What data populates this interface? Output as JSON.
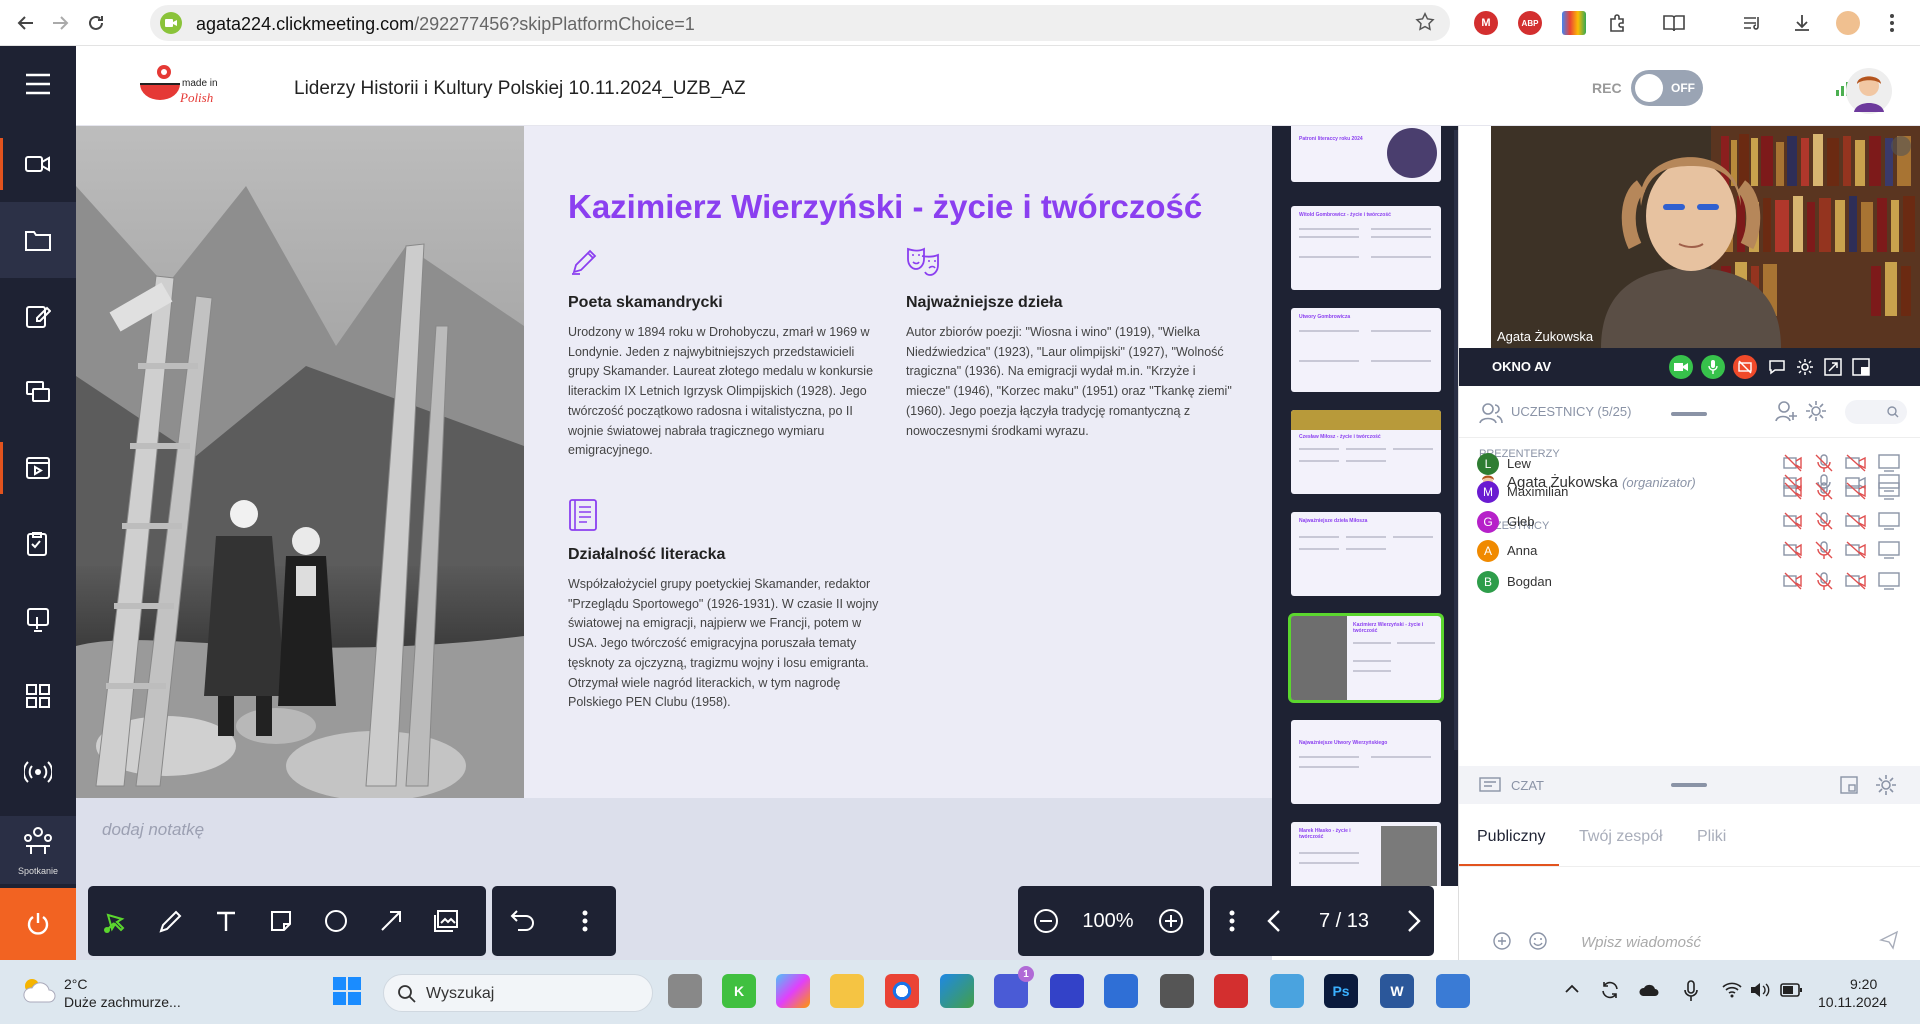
{
  "browser": {
    "url_host": "agata224.clickmeeting.com",
    "url_path": "/292277456?skipPlatformChoice=1"
  },
  "header": {
    "logo_text": "made in Polish",
    "title": "Liderzy Historii i Kultury Polskiej 10.11.2024_UZB_AZ",
    "rec_label": "REC",
    "rec_state": "OFF"
  },
  "rail": {
    "spotkanie_label": "Spotkanie"
  },
  "slide": {
    "title": "Kazimierz Wierzyński - życie i twórczość",
    "sections": [
      {
        "heading": "Poeta skamandrycki",
        "text": "Urodzony w 1894 roku w Drohobyczu, zmarł w 1969 w Londynie. Jeden z najwybitniejszych przedstawicieli grupy Skamander. Laureat złotego medalu w konkursie literackim IX Letnich Igrzysk Olimpijskich (1928). Jego twórczość początkowo radosna i witalistyczna, po II wojnie światowej nabrała tragicznego wymiaru emigracyjnego."
      },
      {
        "heading": "Najważniejsze dzieła",
        "text": "Autor zbiorów poezji: \"Wiosna i wino\" (1919), \"Wielka Niedźwiedzica\" (1923), \"Laur olimpijski\" (1927), \"Wolność tragiczna\" (1936). Na emigracji wydał m.in. \"Krzyże i miecze\" (1946), \"Korzec maku\" (1951) oraz \"Tkankę ziemi\" (1960). Jego poezja łączyła tradycję romantyczną z nowoczesnymi środkami wyrazu."
      },
      {
        "heading": "Działalność literacka",
        "text": "Współzałożyciel grupy poetyckiej Skamander, redaktor \"Przeglądu Sportowego\" (1926-1931). W czasie II wojny światowej na emigracji, najpierw we Francji, potem w USA. Jego twórczość emigracyjna poruszała tematy tęsknoty za ojczyzną, tragizmu wojny i losu emigranta. Otrzymał wiele nagród literackich, w tym nagrodę Polskiego PEN Clubu (1958)."
      }
    ],
    "note_placeholder": "dodaj notatkę"
  },
  "thumbnails": [
    {
      "title": "Patroni literaccy roku 2024"
    },
    {
      "title": "Witold Gombrowicz - życie i twórczość"
    },
    {
      "title": "Utwory Gombrowicza"
    },
    {
      "title": "Czesław Miłosz - życie i twórczość"
    },
    {
      "title": "Najważniejsze dzieła Miłosza"
    },
    {
      "title": "Kazimierz Wierzyński - życie i twórczość"
    },
    {
      "title": "Najważniejsze Utwory Wierzyńskiego"
    },
    {
      "title": "Marek Hłasko - życie i twórczość"
    }
  ],
  "viewer": {
    "zoom": "100%",
    "page_indicator": "7 / 13"
  },
  "video": {
    "presenter_name": "Agata Żukowska",
    "window_title": "OKNO AV"
  },
  "participants": {
    "title": "UCZESTNICY (5/25)",
    "presenters_label": "PREZENTERZY",
    "presenter_name": "Agata Żukowska",
    "presenter_role": "(organizator)",
    "attendees_label": "UCZESTNICY",
    "list": [
      {
        "initial": "L",
        "name": "Lew",
        "color": "#2e7d32"
      },
      {
        "initial": "M",
        "name": "Maximilian",
        "color": "#6a1bd1"
      },
      {
        "initial": "G",
        "name": "Gleb",
        "color": "#b621c9"
      },
      {
        "initial": "A",
        "name": "Anna",
        "color": "#f08a00"
      },
      {
        "initial": "B",
        "name": "Bogdan",
        "color": "#2e9d4a"
      }
    ]
  },
  "chat": {
    "title": "CZAT",
    "tabs": [
      "Publiczny",
      "Twój zespół",
      "Pliki"
    ],
    "placeholder": "Wpisz wiadomość"
  },
  "taskbar": {
    "weather_temp": "2°C",
    "weather_desc": "Duże zachmurze...",
    "search_label": "Wyszukaj",
    "time": "9:20",
    "date": "10.11.2024",
    "badge_count": "1"
  },
  "colors": {
    "accent": "#8b3ff0",
    "dark": "#1e2233",
    "power": "#f26322",
    "current_slide": "#5bd62e"
  }
}
